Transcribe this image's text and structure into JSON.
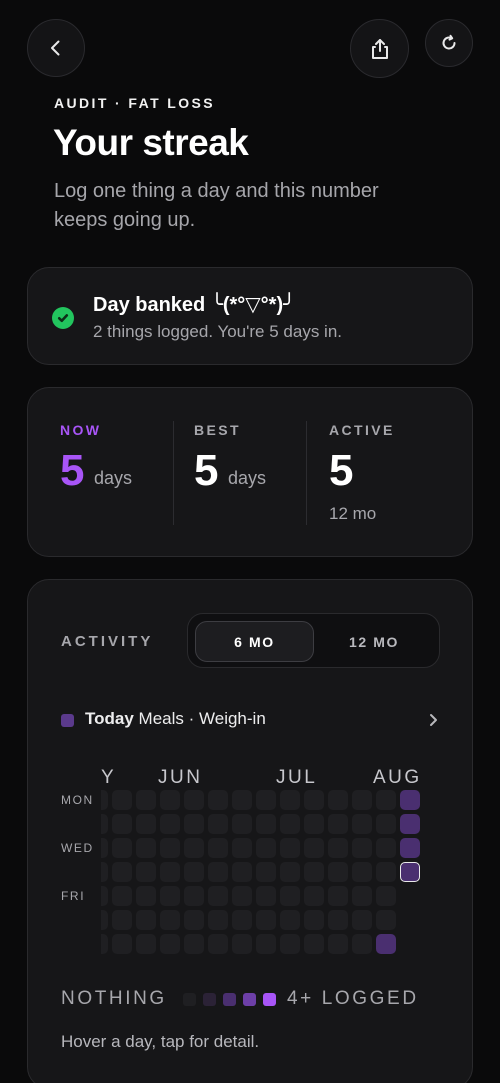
{
  "header": {
    "eyebrow": "AUDIT · FAT LOSS",
    "title": "Your streak",
    "subtitle": "Log one thing a day and this number keeps going up."
  },
  "banked": {
    "title": "Day banked ╰(*°▽°*)╯",
    "subtitle": "2 things logged. You're 5 days in.",
    "status_color": "#22c55e"
  },
  "stats": {
    "now": {
      "label": "NOW",
      "value": "5",
      "unit": "days"
    },
    "best": {
      "label": "BEST",
      "value": "5",
      "unit": "days"
    },
    "active": {
      "label": "ACTIVE",
      "value": "5",
      "sub": "12 mo"
    }
  },
  "activity": {
    "label": "ACTIVITY",
    "tabs": [
      "6 MO",
      "12 MO"
    ],
    "selected_tab": "6 MO",
    "filter_prefix": "Today",
    "filter_text": "Meals · Weigh-in",
    "months": [
      "Y",
      "JUN",
      "JUL",
      "AUG"
    ],
    "day_labels": [
      "MON",
      "WED",
      "FRI"
    ],
    "scale_low": "NOTHING",
    "scale_high": "4+ LOGGED",
    "hint": "Hover a day, tap for detail.",
    "colors": {
      "accent": "#a855f7",
      "empty": "#1f1f22",
      "level1": "#2b2236",
      "level2": "#4a2f70",
      "level3": "#6d3fa8",
      "level4": "#a855f7"
    }
  }
}
